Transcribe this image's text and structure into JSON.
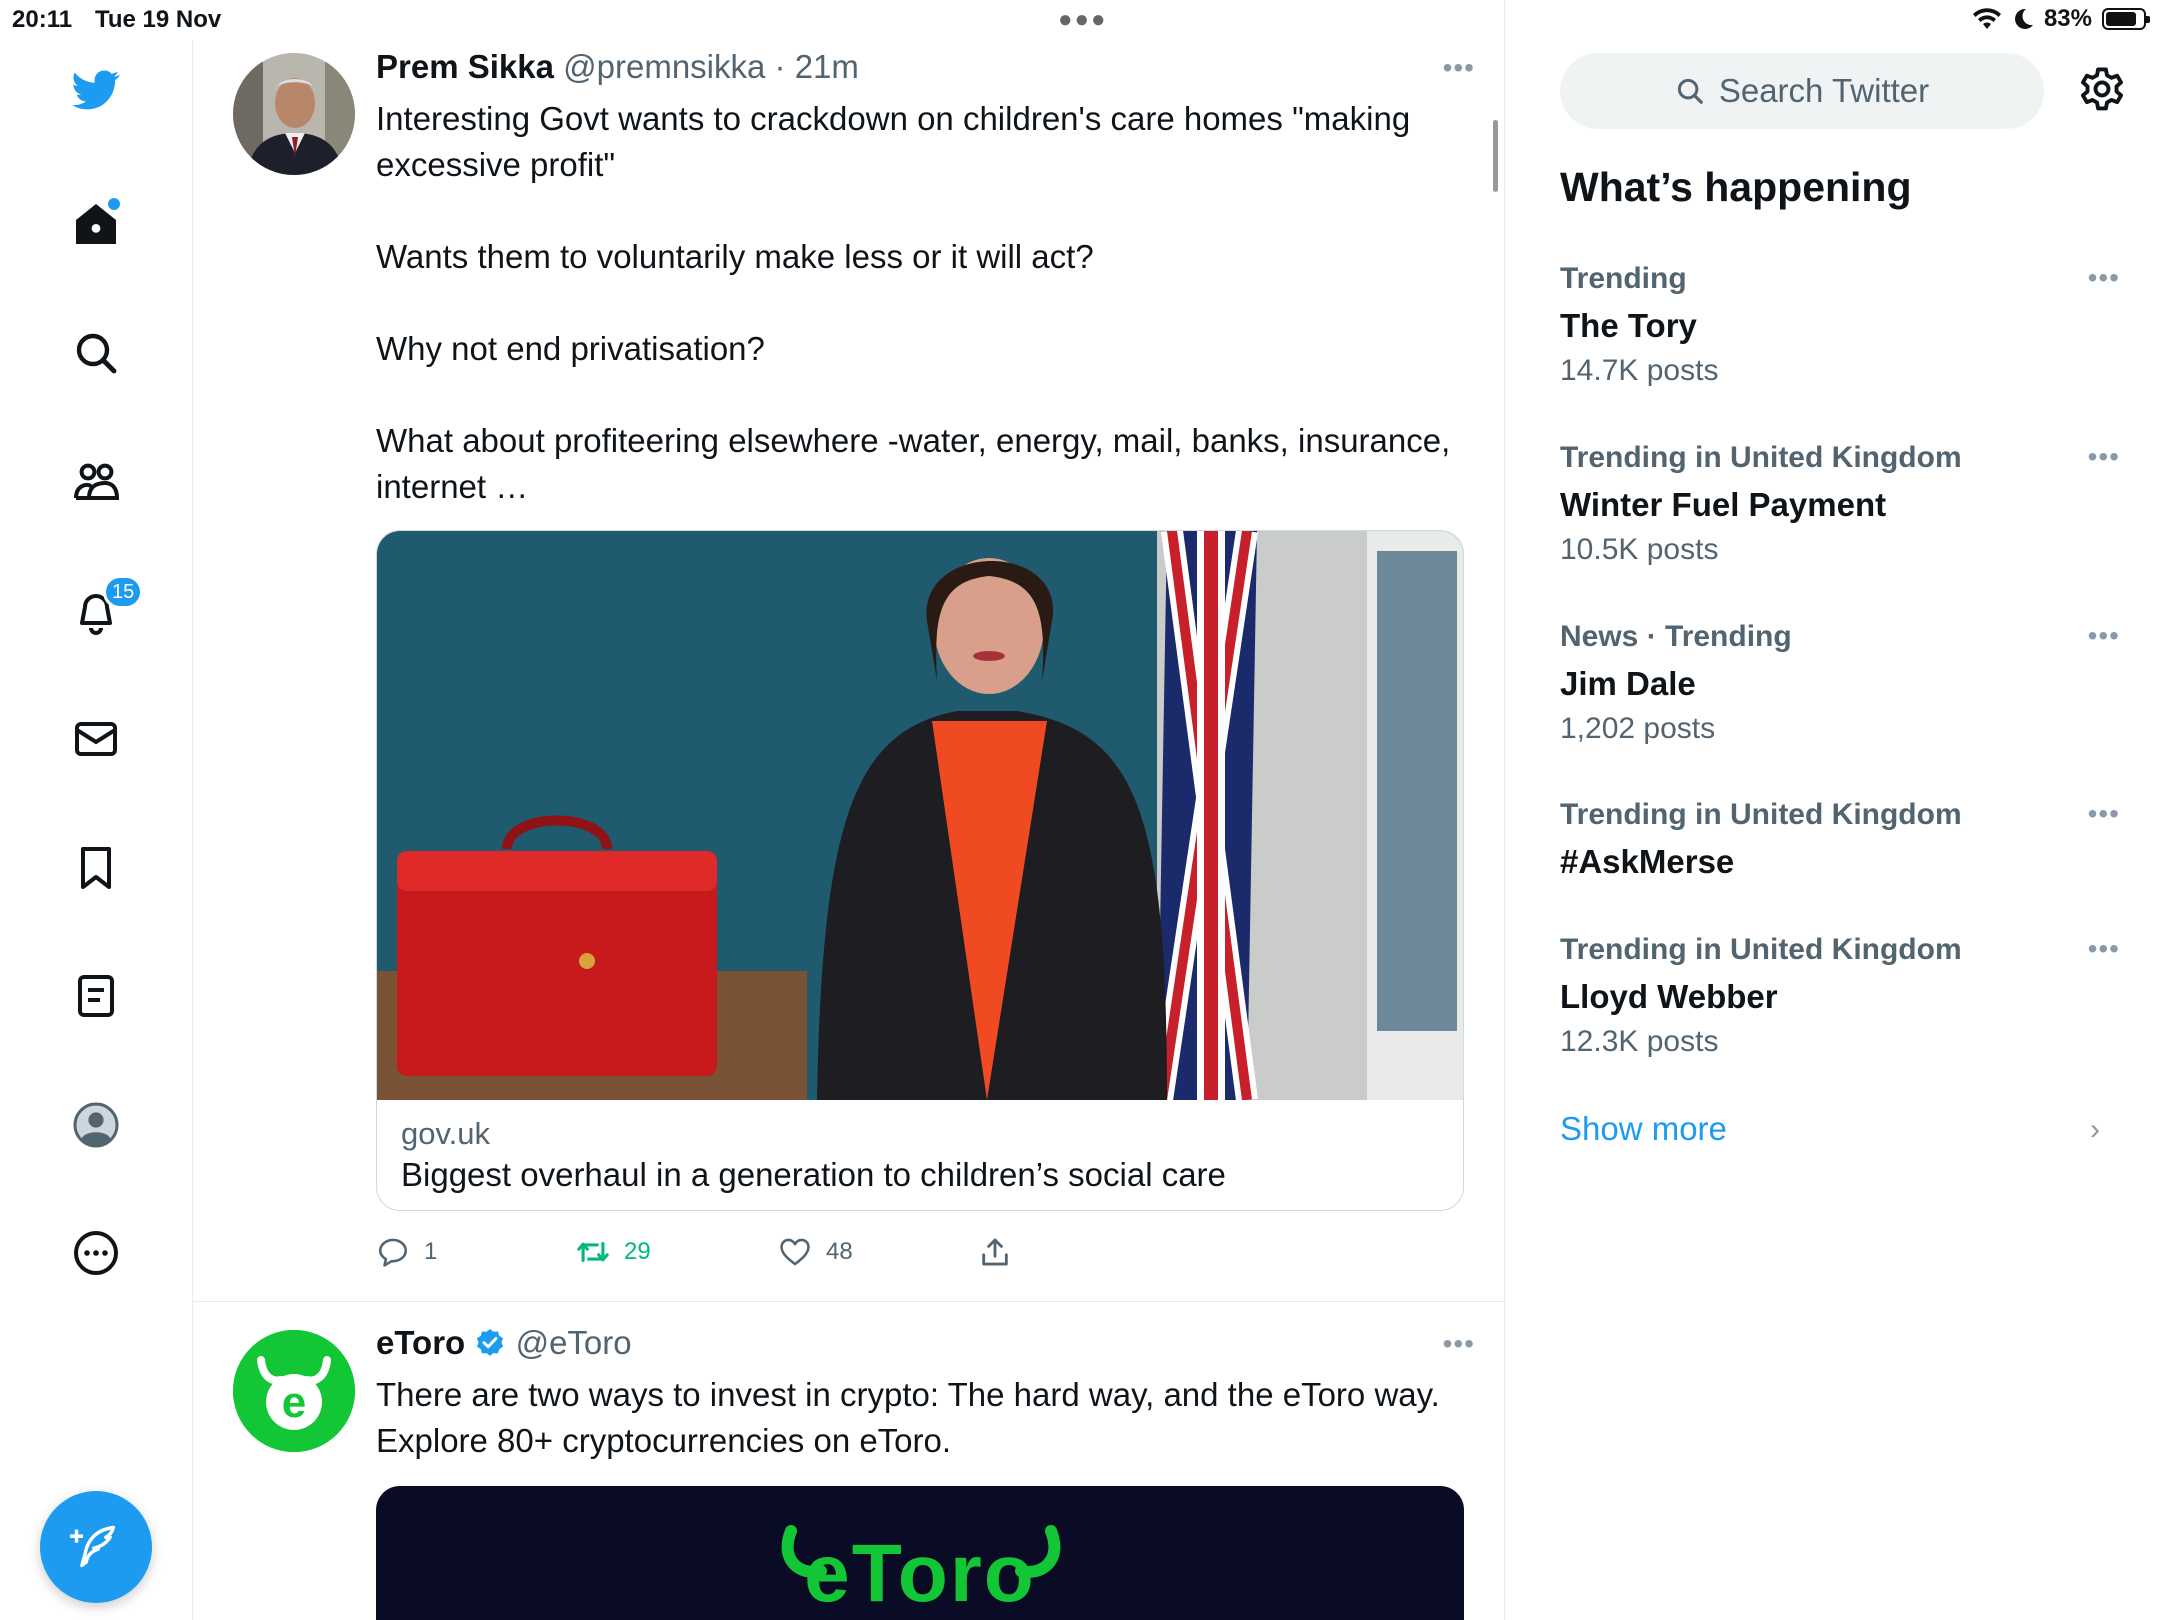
{
  "status_bar": {
    "time": "20:11",
    "date": "Tue 19 Nov",
    "battery": "83%",
    "battery_level": 0.83
  },
  "nav": {
    "notifications_badge": "15"
  },
  "tweets": [
    {
      "name": "Prem Sikka",
      "handle": "@premnsikka",
      "time": "21m",
      "paragraphs": [
        "Interesting Govt wants to crackdown on children's care homes \"making excessive profit\"",
        "Wants them to voluntarily make less or it will act?",
        "Why not end privatisation?",
        "What about profiteering elsewhere -water, energy, mail, banks, insurance, internet …"
      ],
      "card": {
        "domain": "gov.uk",
        "title": "Biggest overhaul in a generation to children’s social care"
      },
      "replies": "1",
      "retweets": "29",
      "likes": "48"
    },
    {
      "name": "eToro",
      "handle": "@eToro",
      "text": "There are two ways to invest in crypto: The hard way, and the eToro way. Explore 80+ cryptocurrencies on eToro.",
      "card_logo": "eToro"
    }
  ],
  "sidebar": {
    "search_placeholder": "Search Twitter",
    "title": "What’s happening",
    "trends": [
      {
        "context": "Trending",
        "name": "The Tory",
        "count": "14.7K posts"
      },
      {
        "context": "Trending in United Kingdom",
        "name": "Winter Fuel Payment",
        "count": "10.5K posts"
      },
      {
        "context": "News · Trending",
        "name": "Jim Dale",
        "count": "1,202 posts"
      },
      {
        "context": "Trending in United Kingdom",
        "name": "#AskMerse",
        "count": ""
      },
      {
        "context": "Trending in United Kingdom",
        "name": "Lloyd Webber",
        "count": "12.3K posts"
      }
    ],
    "show_more": "Show more"
  },
  "colors": {
    "accent": "#1d9bf0",
    "retweet_green": "#00ba7c",
    "etoro_green": "#13c636"
  }
}
